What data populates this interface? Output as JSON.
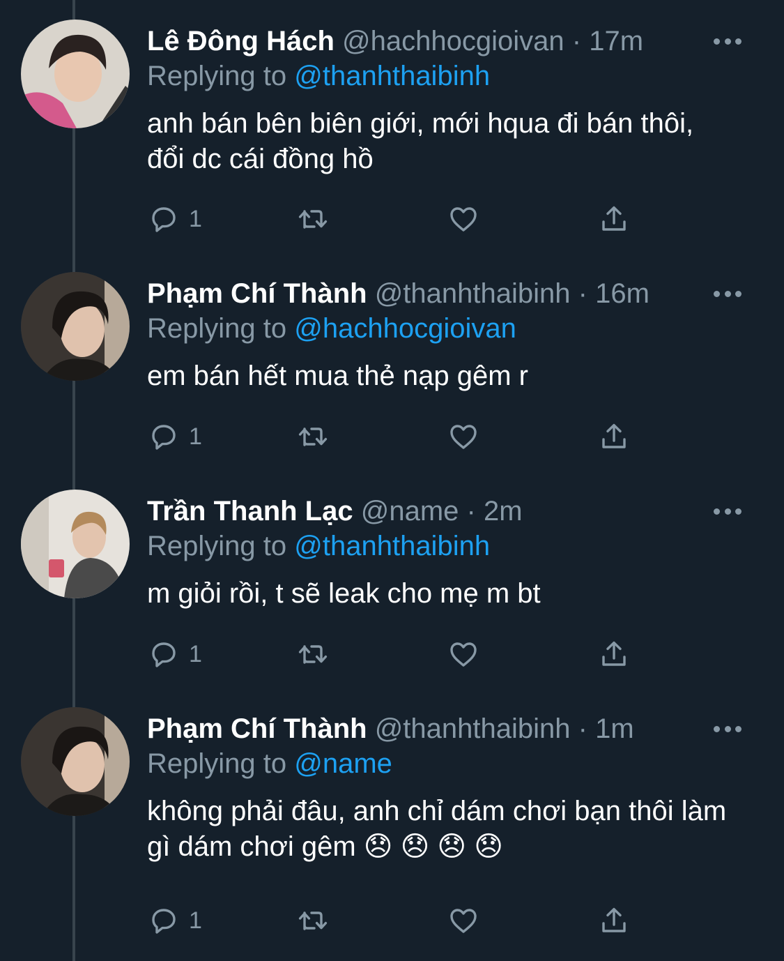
{
  "colors": {
    "background": "#15202b",
    "secondary_text": "#8899a6",
    "accent": "#1da1f2",
    "thread_line": "#38444d"
  },
  "tweets": [
    {
      "name": "Lê Đông Hách",
      "handle": "@hachhocgioivan",
      "separator": "·",
      "time": "17m",
      "replying_prefix": "Replying to",
      "replying_to": "@thanhthaibinh",
      "text": "anh bán bên biên giới, mới hqua đi bán thôi, đổi dc cái đồng hồ",
      "reply_count": "1",
      "icons": [
        "reply-icon",
        "retweet-icon",
        "like-icon",
        "share-icon",
        "more-icon"
      ]
    },
    {
      "name": "Phạm Chí Thành",
      "handle": "@thanhthaibinh",
      "separator": "·",
      "time": "16m",
      "replying_prefix": "Replying to",
      "replying_to": "@hachhocgioivan",
      "text": "em bán hết mua thẻ nạp gêm r",
      "reply_count": "1",
      "icons": [
        "reply-icon",
        "retweet-icon",
        "like-icon",
        "share-icon",
        "more-icon"
      ]
    },
    {
      "name": "Trần Thanh Lạc",
      "handle": "@name",
      "separator": "·",
      "time": "2m",
      "replying_prefix": "Replying to",
      "replying_to": "@thanhthaibinh",
      "text": "m giỏi rồi, t sẽ leak cho mẹ m bt",
      "reply_count": "1",
      "icons": [
        "reply-icon",
        "retweet-icon",
        "like-icon",
        "share-icon",
        "more-icon"
      ]
    },
    {
      "name": "Phạm Chí Thành",
      "handle": "@thanhthaibinh",
      "separator": "·",
      "time": "1m",
      "replying_prefix": "Replying to",
      "replying_to": "@name",
      "text": "không phải đâu, anh chỉ dám chơi bạn thôi làm gì dám chơi gêm 😞 😞 😞 😞",
      "reply_count": "1",
      "icons": [
        "reply-icon",
        "retweet-icon",
        "like-icon",
        "share-icon",
        "more-icon"
      ]
    }
  ]
}
